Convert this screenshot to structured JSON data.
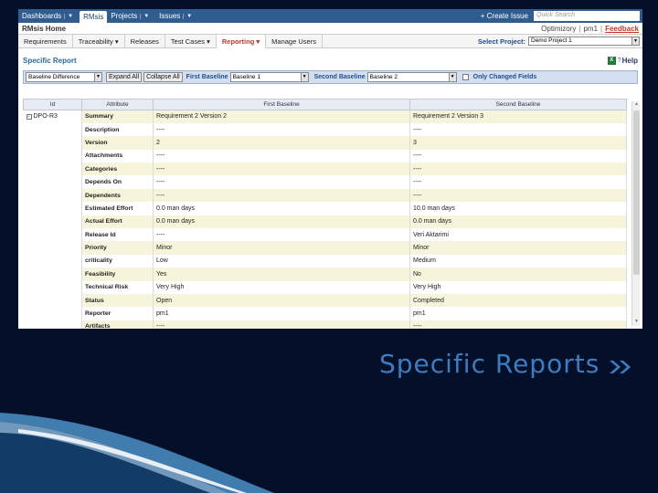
{
  "topnav": {
    "items": [
      {
        "label": "Dashboards",
        "active": false
      },
      {
        "label": "RMsis",
        "active": true
      },
      {
        "label": "Projects",
        "active": false
      },
      {
        "label": "Issues",
        "active": false
      }
    ],
    "create_issue": "+ Create Issue",
    "search_placeholder": "Quick Search"
  },
  "rmsis_header": {
    "title": "RMsis Home",
    "optimizory": "Optimizory",
    "user": "pm1",
    "feedback": "Feedback"
  },
  "module_tabs": [
    {
      "label": "Requirements",
      "active": false,
      "dropdown": false
    },
    {
      "label": "Traceability",
      "active": false,
      "dropdown": true
    },
    {
      "label": "Releases",
      "active": false,
      "dropdown": false
    },
    {
      "label": "Test Cases",
      "active": false,
      "dropdown": true
    },
    {
      "label": "Reporting",
      "active": true,
      "dropdown": true
    },
    {
      "label": "Manage Users",
      "active": false,
      "dropdown": false
    }
  ],
  "project_select": {
    "label": "Select Project:",
    "value": "Demo Project 1"
  },
  "report": {
    "title": "Specific Report",
    "help": "Help"
  },
  "toolbar": {
    "report_type": "Baseline Difference",
    "expand_all": "Expand All",
    "collapse_all": "Collapse All",
    "first_label": "First Baseline",
    "first_value": "Baseline 1",
    "second_label": "Second Baseline",
    "second_value": "Baseline 2",
    "only_changed": "Only Changed Fields"
  },
  "grid": {
    "headers": [
      "Id",
      "Attribute",
      "First Baseline",
      "Second Baseline"
    ],
    "id_value": "DPO-R3",
    "rows": [
      {
        "attr": "Summary",
        "first": "Requirement 2 Version 2",
        "second": "Requirement 2 Version 3"
      },
      {
        "attr": "Description",
        "first": "----",
        "second": "----"
      },
      {
        "attr": "Version",
        "first": "2",
        "second": "3"
      },
      {
        "attr": "Attachments",
        "first": "----",
        "second": "----"
      },
      {
        "attr": "Categories",
        "first": "----",
        "second": "----"
      },
      {
        "attr": "Depends On",
        "first": "----",
        "second": "----"
      },
      {
        "attr": "Dependents",
        "first": "----",
        "second": "----"
      },
      {
        "attr": "Estimated Effort",
        "first": "0.0 man days",
        "second": "10.0 man days"
      },
      {
        "attr": "Actual Effort",
        "first": "0.0 man days",
        "second": "0.0 man days"
      },
      {
        "attr": "Release Id",
        "first": "----",
        "second": "Veri Aktarimi"
      },
      {
        "attr": "Priority",
        "first": "Minor",
        "second": "Minor"
      },
      {
        "attr": "criticality",
        "first": "Low",
        "second": "Medium"
      },
      {
        "attr": "Feasibility",
        "first": "Yes",
        "second": "No"
      },
      {
        "attr": "Technical Risk",
        "first": "Very High",
        "second": "Very High"
      },
      {
        "attr": "Status",
        "first": "Open",
        "second": "Completed"
      },
      {
        "attr": "Reporter",
        "first": "pm1",
        "second": "pm1"
      },
      {
        "attr": "Artifacts",
        "first": "----",
        "second": "----"
      }
    ]
  },
  "slide": {
    "caption": "Specific Reports"
  },
  "colors": {
    "background": "#04102a",
    "caption": "#3d7cc0",
    "nav": "#2f5d8f",
    "row_highlight": "#f7f4dc"
  }
}
